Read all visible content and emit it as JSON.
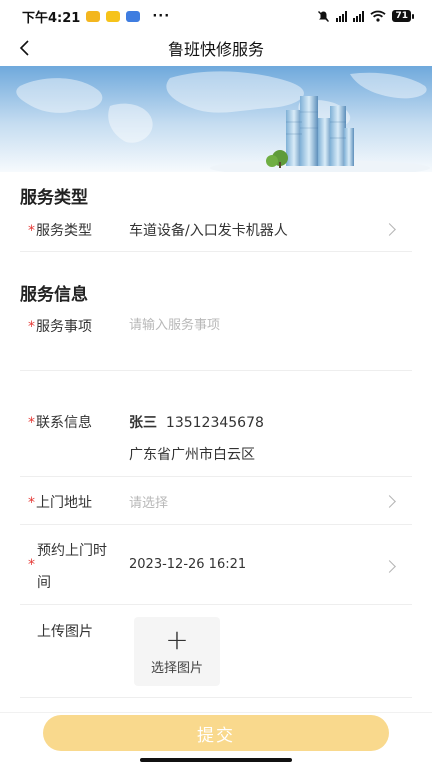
{
  "status_bar": {
    "time": "下午4:21",
    "more": "···",
    "battery": "71"
  },
  "header": {
    "title": "鲁班快修服务"
  },
  "service_type_section": {
    "title": "服务类型",
    "row": {
      "label": "服务类型",
      "value": "车道设备/入口发卡机器人"
    }
  },
  "service_info_section": {
    "title": "服务信息",
    "service_item": {
      "label": "服务事项",
      "placeholder": "请输入服务事项"
    },
    "contact": {
      "label": "联系信息",
      "name": "张三",
      "phone": "13512345678",
      "region": "广东省广州市白云区"
    },
    "address": {
      "label": "上门地址",
      "placeholder": "请选择"
    },
    "appointment": {
      "label_line1": "预约上门时",
      "label_line2": "间",
      "value": "2023-12-26 16:21"
    },
    "upload": {
      "label": "上传图片",
      "plus": "+",
      "button_label": "选择图片"
    }
  },
  "required_mark": "*",
  "footer": {
    "submit_label": "提交"
  },
  "colors": {
    "accent": "#F9D98D",
    "required": "#E53935",
    "placeholder": "#B8B8B8"
  },
  "icons": {
    "back": "back-arrow-icon",
    "chevron": "chevron-right-icon",
    "upload": "plus-icon"
  }
}
